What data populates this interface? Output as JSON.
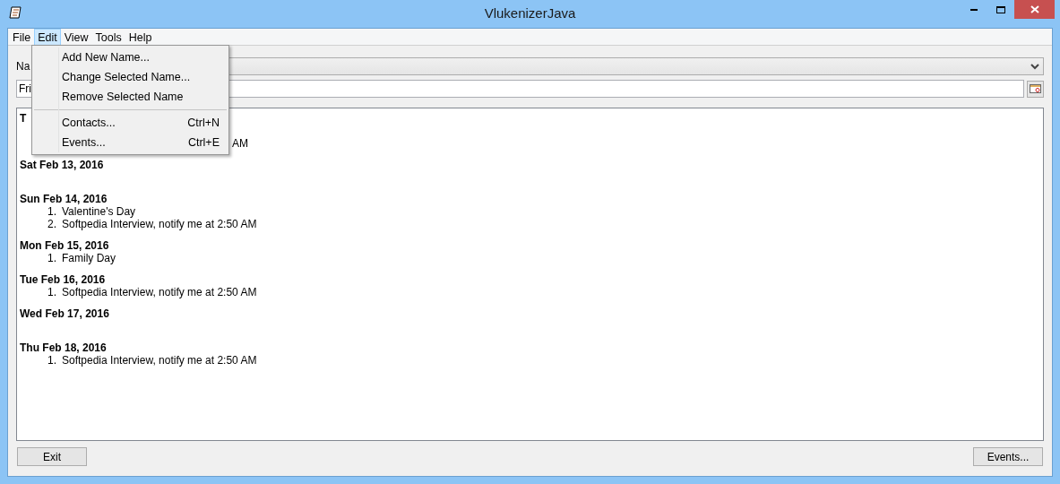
{
  "window": {
    "title": "VlukenizerJava"
  },
  "menu_bar": [
    {
      "label": "File",
      "selected": false
    },
    {
      "label": "Edit",
      "selected": true
    },
    {
      "label": "View",
      "selected": false
    },
    {
      "label": "Tools",
      "selected": false
    },
    {
      "label": "Help",
      "selected": false
    }
  ],
  "edit_menu": [
    {
      "kind": "item",
      "label": "Add New Name..."
    },
    {
      "kind": "item",
      "label": "Change Selected Name..."
    },
    {
      "kind": "item",
      "label": "Remove Selected Name"
    },
    {
      "kind": "separator"
    },
    {
      "kind": "item",
      "label": "Contacts...",
      "shortcut": "Ctrl+N"
    },
    {
      "kind": "item",
      "label": "Events...",
      "shortcut": "Ctrl+E"
    }
  ],
  "name_label": "Na",
  "date_field": {
    "value": "Fri"
  },
  "days": [
    {
      "heading": "T",
      "items": [
        {
          "kind": "fragment",
          "text": "AM"
        }
      ]
    },
    {
      "heading": "Sat Feb 13, 2016"
    },
    {
      "heading": "Sun Feb 14, 2016",
      "items": [
        {
          "kind": "entry",
          "number": "1.",
          "text": "Valentine's Day"
        },
        {
          "kind": "entry",
          "number": "2.",
          "text": "Softpedia Interview, notify me at 2:50 AM"
        }
      ]
    },
    {
      "heading": "Mon Feb 15, 2016",
      "items": [
        {
          "kind": "entry",
          "number": "1.",
          "text": "Family Day"
        }
      ]
    },
    {
      "heading": "Tue Feb 16, 2016",
      "items": [
        {
          "kind": "entry",
          "number": "1.",
          "text": "Softpedia Interview, notify me at 2:50 AM"
        }
      ]
    },
    {
      "heading": "Wed Feb 17, 2016"
    },
    {
      "heading": "Thu Feb 18, 2016",
      "items": [
        {
          "kind": "entry",
          "number": "1.",
          "text": "Softpedia Interview, notify me at 2:50 AM"
        }
      ]
    }
  ],
  "buttons": {
    "exit": "Exit",
    "events": "Events..."
  }
}
